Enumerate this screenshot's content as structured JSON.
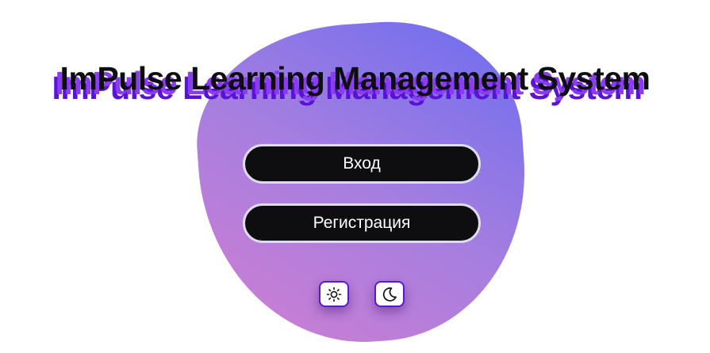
{
  "title": "ImPulse Learning Management System",
  "buttons": {
    "login_label": "Вход",
    "register_label": "Регистрация"
  },
  "theme_toggle": {
    "light_icon": "sun-icon",
    "dark_icon": "moon-icon"
  },
  "colors": {
    "blob_gradient_start": "#6b6cf0",
    "blob_gradient_end": "#d27ed2",
    "title_shadow_1": "#8a3df0",
    "title_shadow_2": "#5a12d6",
    "button_bg": "#0e0e10",
    "button_border": "#dcdcec",
    "theme_button_border": "#5a18d0"
  }
}
